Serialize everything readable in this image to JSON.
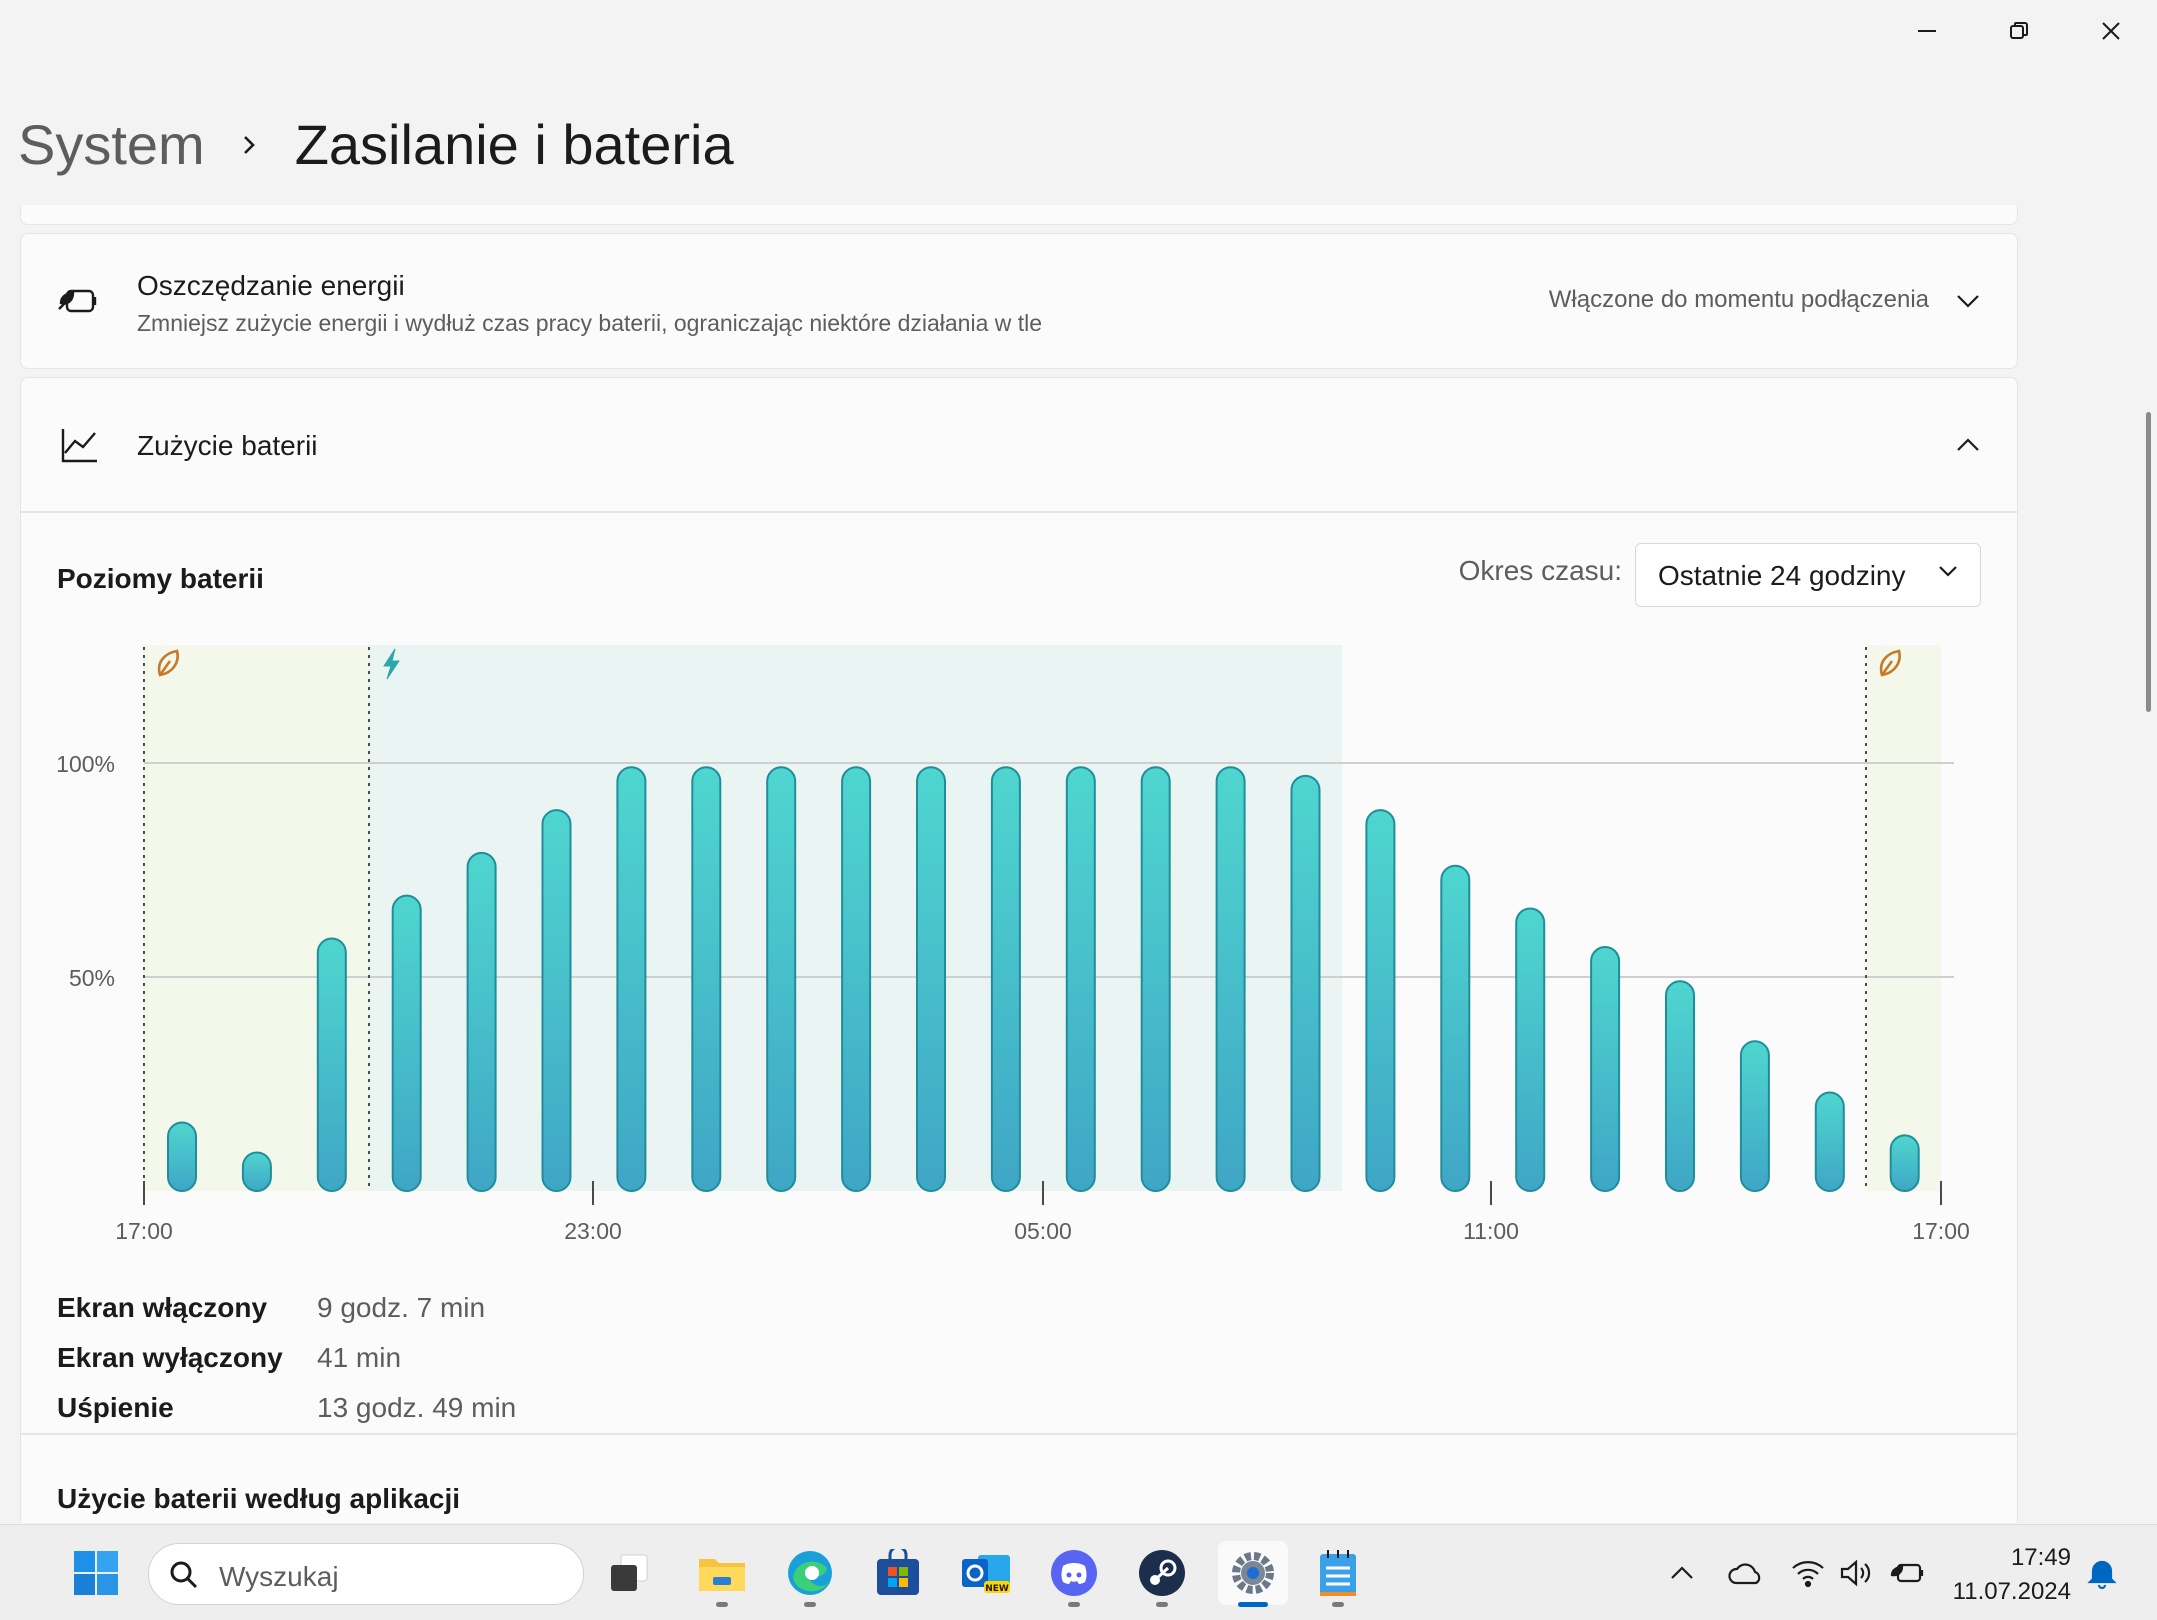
{
  "window": {
    "controls": [
      "minimize",
      "restore",
      "close"
    ]
  },
  "breadcrumb": {
    "parent": "System",
    "current": "Zasilanie i bateria"
  },
  "energy_saver": {
    "icon": "battery-leaf-icon",
    "title": "Oszczędzanie energii",
    "subtitle": "Zmniejsz zużycie energii i wydłuż czas pracy baterii, ograniczając niektóre działania w tle",
    "value": "Włączone do momentu podłączenia"
  },
  "battery_usage": {
    "icon": "chart-line-icon",
    "title": "Zużycie baterii",
    "levels_title": "Poziomy baterii",
    "period_label": "Okres czasu:",
    "period_value": "Ostatnie 24 godziny",
    "stats": [
      {
        "label": "Ekran włączony",
        "value": "9 godz. 7 min"
      },
      {
        "label": "Ekran wyłączony",
        "value": "41 min"
      },
      {
        "label": "Uśpienie",
        "value": "13 godz. 49 min"
      }
    ],
    "next_section_title": "Użycie baterii według aplikacji"
  },
  "chart_data": {
    "type": "bar",
    "y_ticks": [
      "100%",
      "50%"
    ],
    "ylim": [
      0,
      100
    ],
    "x_ticks": [
      "17:00",
      "23:00",
      "05:00",
      "11:00",
      "17:00"
    ],
    "values": [
      16,
      9,
      59,
      69,
      79,
      89,
      99,
      99,
      99,
      99,
      99,
      99,
      99,
      99,
      99,
      97,
      89,
      76,
      66,
      57,
      49,
      35,
      23,
      13
    ],
    "markers": [
      {
        "type": "energy-saver",
        "icon": "leaf-icon"
      },
      {
        "type": "charging",
        "icon": "lightning-icon"
      },
      {
        "type": "energy-saver",
        "icon": "leaf-icon"
      }
    ],
    "colors": {
      "bar_top": "#4fd6cf",
      "bar_bottom": "#3fa6c6",
      "bar_stroke": "#1f8e9a",
      "saver_region": "#f3f8ea",
      "charging_region": "#eaf5f3",
      "leaf": "#c67a28",
      "bolt": "#2ba7a7"
    }
  },
  "taskbar": {
    "search_placeholder": "Wyszukaj",
    "apps": [
      "windows-start-icon",
      "task-view-icon",
      "file-explorer-icon",
      "edge-icon",
      "store-icon",
      "outlook-new-icon",
      "discord-icon",
      "steam-icon",
      "settings-icon",
      "notepad-icon"
    ],
    "time": "17:49",
    "date": "11.07.2024"
  }
}
